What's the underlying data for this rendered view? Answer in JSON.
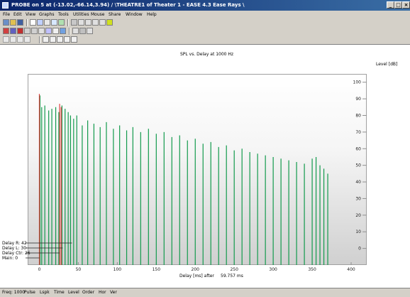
{
  "window": {
    "title": "PROBE on 5 at (-13.02,-66.14,3.94) / \\THEATRE1 of Theater 1 - EASE 4.3 Ease Rays \\",
    "app_icon": "ease-app-icon"
  },
  "menu": [
    "File",
    "Edit",
    "View",
    "Graphs",
    "Tools",
    "Utilities",
    "Mouse",
    "Share",
    "Window",
    "Help"
  ],
  "toolbar": {
    "row1": [
      "new-icon",
      "open-icon",
      "save-icon",
      "pointer-icon",
      "zoom-in-icon",
      "pan-icon",
      "fit-icon",
      "grid-icon",
      "print-icon",
      "up-icon",
      "down-icon",
      "left-icon",
      "right-icon",
      "settings-icon"
    ],
    "row2": [
      "chart-icon",
      "print-icon",
      "copy-icon",
      "back-icon",
      "forward-icon",
      "table-icon",
      "calc-icon",
      "ray-icon",
      "export-icon",
      "view-icon",
      "scale-icon",
      "zoom-icon"
    ],
    "row3": [
      "step-back-icon",
      "prev-icon",
      "next-icon",
      "step-forward-icon",
      "layer1-icon",
      "layer2-icon",
      "layer3-icon",
      "layer4-icon",
      "layer5-icon"
    ]
  },
  "chart_data": {
    "type": "bar",
    "title": "SPL vs. Delay at 1000 Hz",
    "ylabel": "Level [dB]",
    "xlabel": "Delay [ms] after",
    "xlabel_value": "59.757 ms",
    "xlim": [
      -15,
      420
    ],
    "ylim": [
      -10,
      105
    ],
    "xticks": [
      "0",
      "50",
      "100",
      "150",
      "200",
      "250",
      "300",
      "350",
      "400"
    ],
    "yticks": [
      "100",
      "90",
      "80",
      "70",
      "60",
      "50",
      "40",
      "30",
      "20",
      "10",
      "0"
    ],
    "arrivals_main": [
      [
        0.8,
        92
      ],
      [
        3,
        85
      ],
      [
        7,
        86
      ],
      [
        12,
        83
      ],
      [
        16,
        84
      ],
      [
        21,
        85
      ],
      [
        25,
        82
      ],
      [
        29,
        86
      ],
      [
        33,
        84
      ],
      [
        37,
        82
      ],
      [
        40,
        80
      ],
      [
        44,
        78
      ],
      [
        48,
        80
      ],
      [
        55,
        74
      ],
      [
        62,
        77
      ],
      [
        70,
        75
      ],
      [
        78,
        73
      ],
      [
        86,
        76
      ],
      [
        95,
        72
      ],
      [
        103,
        74
      ],
      [
        112,
        71
      ],
      [
        120,
        73
      ],
      [
        130,
        70
      ],
      [
        140,
        72
      ],
      [
        150,
        69
      ],
      [
        160,
        70
      ],
      [
        170,
        67
      ],
      [
        180,
        68
      ],
      [
        190,
        65
      ],
      [
        200,
        66
      ],
      [
        210,
        63
      ],
      [
        220,
        64
      ],
      [
        230,
        61
      ],
      [
        240,
        62
      ],
      [
        250,
        59
      ],
      [
        260,
        60
      ],
      [
        270,
        58
      ],
      [
        280,
        57
      ],
      [
        290,
        56
      ],
      [
        300,
        55
      ],
      [
        310,
        54
      ],
      [
        320,
        53
      ],
      [
        330,
        52
      ],
      [
        340,
        51
      ],
      [
        350,
        54
      ],
      [
        355,
        55
      ],
      [
        360,
        50
      ],
      [
        365,
        48
      ],
      [
        370,
        45
      ]
    ],
    "arrivals_highlight": [
      [
        0,
        93
      ],
      [
        26,
        87
      ],
      [
        28,
        85
      ]
    ],
    "series": [
      {
        "name": "Main",
        "value": "0"
      },
      {
        "name": "Delay Ctr",
        "value": "26"
      },
      {
        "name": "Delay L",
        "value": "30"
      },
      {
        "name": "Delay R",
        "value": "42"
      }
    ],
    "colors": {
      "bars": "#129a4c",
      "highlight": "#e04040",
      "legend_line": "#202020"
    }
  },
  "legend": [
    {
      "label": "Delay R: 42"
    },
    {
      "label": "Delay L: 30"
    },
    {
      "label": "Delay Ctr: 26"
    },
    {
      "label": "Main: 0"
    }
  ],
  "status": [
    "Freq: 1000",
    "Pulse",
    "Lspk",
    "Time",
    "Level",
    "Order",
    "Hor",
    "Ver"
  ]
}
